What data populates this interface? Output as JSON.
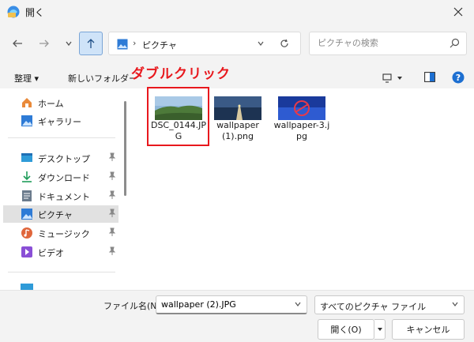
{
  "window": {
    "title": "開く",
    "app_icon": "folder-globe-icon",
    "close_icon": "close-icon"
  },
  "nav": {
    "back_icon": "arrow-left-icon",
    "forward_icon": "arrow-right-icon",
    "recent_icon": "chevron-down-icon",
    "up_icon": "arrow-up-icon",
    "address_separator": "›",
    "address_path": "ピクチャ",
    "search_placeholder": "ピクチャの検索"
  },
  "toolbar": {
    "organize_label": "整理 ▾",
    "new_folder_label": "新しいフォルダー",
    "view_icon": "view-options-icon",
    "preview_icon": "preview-pane-icon",
    "help_icon": "help-icon"
  },
  "annotation": {
    "text": "ダブルクリック",
    "color": "#e8181d"
  },
  "sidebar": {
    "items": [
      {
        "label": "ホーム",
        "icon": "home-icon"
      },
      {
        "label": "ギャラリー",
        "icon": "gallery-icon"
      },
      {
        "label": "デスクトップ",
        "icon": "desktop-icon"
      },
      {
        "label": "ダウンロード",
        "icon": "download-icon"
      },
      {
        "label": "ドキュメント",
        "icon": "document-icon"
      },
      {
        "label": "ピクチャ",
        "icon": "pictures-icon"
      },
      {
        "label": "ミュージック",
        "icon": "music-icon"
      },
      {
        "label": "ビデオ",
        "icon": "video-icon"
      }
    ],
    "pin_icon": "pin-icon"
  },
  "files": [
    {
      "name": "DSC_0144.JPG",
      "thumb": "landscape-thumbnail"
    },
    {
      "name": "wallpaper (1).png",
      "thumb": "pier-thumbnail"
    },
    {
      "name": "wallpaper-3.jpg",
      "thumb": "blue-logo-thumbnail"
    }
  ],
  "footer": {
    "filename_label": "ファイル名(N):",
    "filename_value": "wallpaper (2).JPG",
    "filetype_value": "すべてのピクチャ ファイル",
    "open_label": "開く(O)",
    "cancel_label": "キャンセル"
  },
  "colors": {
    "accent": "#0067c0",
    "highlight_red": "#e8181d",
    "selected_bg": "#e1e1e1"
  }
}
